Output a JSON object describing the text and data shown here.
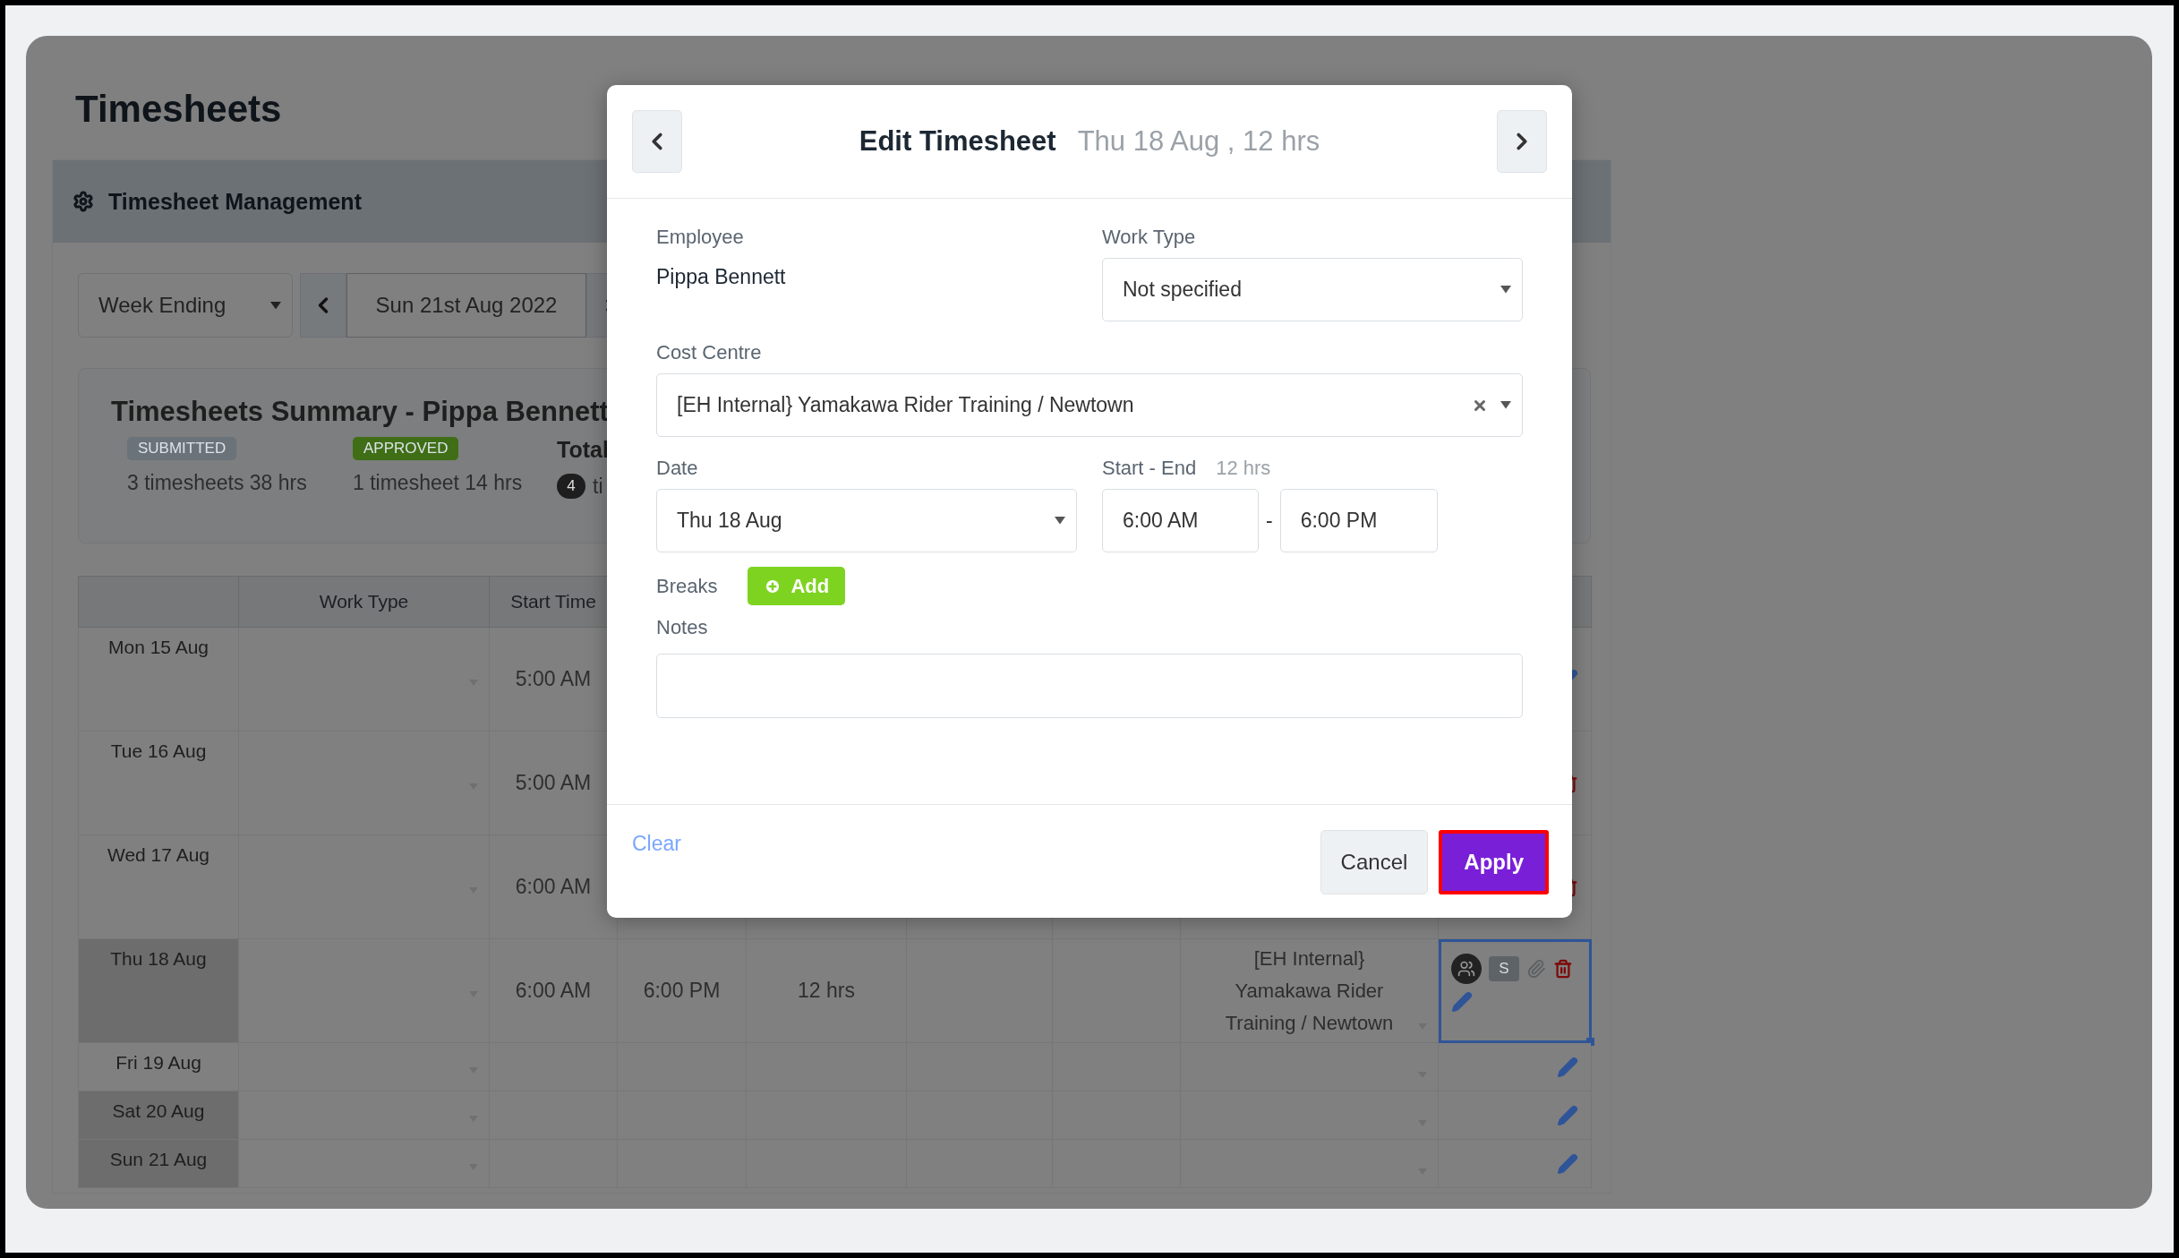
{
  "page": {
    "title": "Timesheets"
  },
  "management_bar": {
    "title": "Timesheet Management"
  },
  "filters": {
    "period": "Week Ending",
    "date": "Sun 21st Aug 2022"
  },
  "summary": {
    "title": "Timesheets Summary - Pippa Bennett",
    "groups": [
      {
        "kind": "badge",
        "badge": "SUBMITTED",
        "color": "#6a727a",
        "detail": "3 timesheets 38 hrs"
      },
      {
        "kind": "badge",
        "badge": "APPROVED",
        "color": "#3f6e17",
        "detail": "1 timesheet 14 hrs"
      },
      {
        "kind": "total",
        "label": "Total",
        "count": "4",
        "detail": "ti"
      }
    ]
  },
  "table": {
    "columns": [
      "",
      "Work Type",
      "Start Time"
    ],
    "rows": [
      {
        "date": "Mon 15 Aug",
        "shaded": false,
        "start": "5:00 AM",
        "actions": [
          {
            "kind": "edit"
          }
        ],
        "selected": false
      },
      {
        "date": "Tue 16 Aug",
        "shaded": false,
        "start": "5:00 AM",
        "actions": [
          {
            "kind": "delete"
          }
        ],
        "selected": false
      },
      {
        "date": "Wed 17 Aug",
        "shaded": false,
        "start": "6:00 AM",
        "actions": [
          {
            "kind": "delete"
          }
        ],
        "selected": false
      },
      {
        "date": "Thu 18 Aug",
        "shaded": true,
        "start": "6:00 AM",
        "end": "6:00 PM",
        "hours": "12 hrs",
        "cost_centre": "[EH Internal} Yamakawa Rider Training / Newtown",
        "actions": [
          {
            "kind": "avatar"
          },
          {
            "kind": "status",
            "label": "S"
          },
          {
            "kind": "attach"
          },
          {
            "kind": "delete"
          },
          {
            "kind": "edit"
          }
        ],
        "selected": true
      },
      {
        "date": "Fri 19 Aug",
        "shaded": false,
        "actions": [
          {
            "kind": "edit"
          }
        ],
        "selected": false
      },
      {
        "date": "Sat 20 Aug",
        "shaded": true,
        "actions": [
          {
            "kind": "edit"
          }
        ],
        "selected": false
      },
      {
        "date": "Sun 21 Aug",
        "shaded": true,
        "actions": [
          {
            "kind": "edit"
          }
        ],
        "selected": false
      }
    ]
  },
  "modal": {
    "title": "Edit Timesheet",
    "subtitle": "Thu 18 Aug , 12 hrs",
    "employee": {
      "label": "Employee",
      "value": "Pippa Bennett"
    },
    "work_type": {
      "label": "Work Type",
      "value": "Not specified"
    },
    "cost_centre": {
      "label": "Cost Centre",
      "value": "[EH Internal} Yamakawa Rider Training / Newtown"
    },
    "date": {
      "label": "Date",
      "value": "Thu 18 Aug"
    },
    "start_end": {
      "label": "Start - End",
      "duration": "12 hrs",
      "start": "6:00 AM",
      "separator": "-",
      "end": "6:00 PM"
    },
    "breaks": {
      "label": "Breaks",
      "button": "Add"
    },
    "notes": {
      "label": "Notes"
    },
    "footer": {
      "clear": "Clear",
      "cancel": "Cancel",
      "apply": "Apply",
      "apply_highlighted": true
    }
  }
}
